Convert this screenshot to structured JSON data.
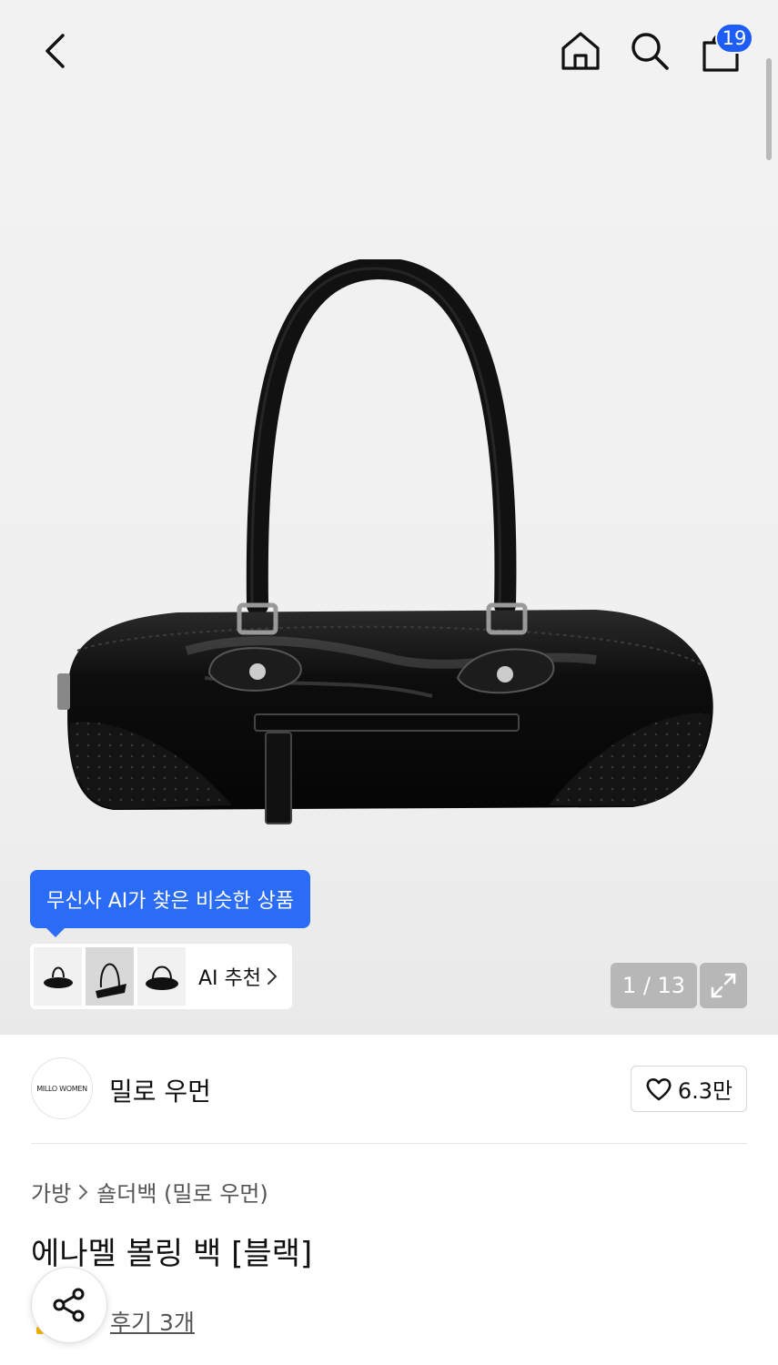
{
  "header": {
    "back_icon": "chevron-left-icon",
    "home_icon": "home-icon",
    "search_icon": "search-icon",
    "cart_icon": "shopping-bag-icon",
    "cart_count": "19"
  },
  "gallery": {
    "ai_tooltip": "무신사 AI가 찾은 비슷한 상품",
    "ai_recommend_label": "AI 추천",
    "page_counter": "1 / 13",
    "expand_icon": "expand-arrows-icon"
  },
  "brand": {
    "logo_text": "MILLO WOMEN",
    "name": "밀로 우먼",
    "like_count": "6.3만"
  },
  "product": {
    "breadcrumb": [
      "가방",
      "숄더백 (밀로 우먼)"
    ],
    "title": "에나멜 볼링 백 [블랙]",
    "review_link": "후기 3개"
  },
  "colors": {
    "accent_blue": "#2a6cf6",
    "badge_blue": "#1d5cf5"
  }
}
